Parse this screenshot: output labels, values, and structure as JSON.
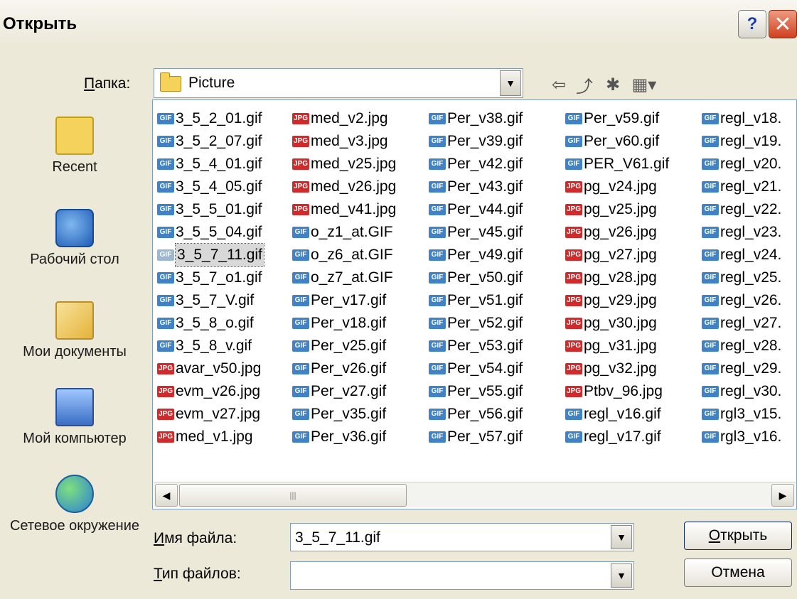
{
  "window": {
    "title": "Открыть",
    "help_label": "?",
    "close_label": "✕"
  },
  "folder": {
    "label": "Папка:",
    "accesskey": "П",
    "label_rest": "апка:",
    "value": "Picture"
  },
  "places": [
    {
      "label": "Recent",
      "icon": "recent-folder-icon"
    },
    {
      "label": "Рабочий стол",
      "icon": "desktop-icon"
    },
    {
      "label": "Мои документы",
      "icon": "my-documents-icon"
    },
    {
      "label": "Мой компьютер",
      "icon": "my-computer-icon"
    },
    {
      "label": "Сетевое окружение",
      "icon": "network-icon"
    }
  ],
  "columns": [
    [
      {
        "name": "3_5_2_01.gif",
        "type": "gif"
      },
      {
        "name": "3_5_2_07.gif",
        "type": "gif"
      },
      {
        "name": "3_5_4_01.gif",
        "type": "gif"
      },
      {
        "name": "3_5_4_05.gif",
        "type": "gif"
      },
      {
        "name": "3_5_5_01.gif",
        "type": "gif"
      },
      {
        "name": "3_5_5_04.gif",
        "type": "gif"
      },
      {
        "name": "3_5_7_11.gif",
        "type": "gif",
        "selected": true
      },
      {
        "name": "3_5_7_o1.gif",
        "type": "gif"
      },
      {
        "name": "3_5_7_V.gif",
        "type": "gif"
      },
      {
        "name": "3_5_8_o.gif",
        "type": "gif"
      },
      {
        "name": "3_5_8_v.gif",
        "type": "gif"
      },
      {
        "name": "avar_v50.jpg",
        "type": "jpg"
      },
      {
        "name": "evm_v26.jpg",
        "type": "jpg"
      },
      {
        "name": "evm_v27.jpg",
        "type": "jpg"
      },
      {
        "name": "med_v1.jpg",
        "type": "jpg"
      }
    ],
    [
      {
        "name": "med_v2.jpg",
        "type": "jpg"
      },
      {
        "name": "med_v3.jpg",
        "type": "jpg"
      },
      {
        "name": "med_v25.jpg",
        "type": "jpg"
      },
      {
        "name": "med_v26.jpg",
        "type": "jpg"
      },
      {
        "name": "med_v41.jpg",
        "type": "jpg"
      },
      {
        "name": "o_z1_at.GIF",
        "type": "gif"
      },
      {
        "name": "o_z6_at.GIF",
        "type": "gif"
      },
      {
        "name": "o_z7_at.GIF",
        "type": "gif"
      },
      {
        "name": "Per_v17.gif",
        "type": "gif"
      },
      {
        "name": "Per_v18.gif",
        "type": "gif"
      },
      {
        "name": "Per_v25.gif",
        "type": "gif"
      },
      {
        "name": "Per_v26.gif",
        "type": "gif"
      },
      {
        "name": "Per_v27.gif",
        "type": "gif"
      },
      {
        "name": "Per_v35.gif",
        "type": "gif"
      },
      {
        "name": "Per_v36.gif",
        "type": "gif"
      }
    ],
    [
      {
        "name": "Per_v38.gif",
        "type": "gif"
      },
      {
        "name": "Per_v39.gif",
        "type": "gif"
      },
      {
        "name": "Per_v42.gif",
        "type": "gif"
      },
      {
        "name": "Per_v43.gif",
        "type": "gif"
      },
      {
        "name": "Per_v44.gif",
        "type": "gif"
      },
      {
        "name": "Per_v45.gif",
        "type": "gif"
      },
      {
        "name": "Per_v49.gif",
        "type": "gif"
      },
      {
        "name": "Per_v50.gif",
        "type": "gif"
      },
      {
        "name": "Per_v51.gif",
        "type": "gif"
      },
      {
        "name": "Per_v52.gif",
        "type": "gif"
      },
      {
        "name": "Per_v53.gif",
        "type": "gif"
      },
      {
        "name": "Per_v54.gif",
        "type": "gif"
      },
      {
        "name": "Per_v55.gif",
        "type": "gif"
      },
      {
        "name": "Per_v56.gif",
        "type": "gif"
      },
      {
        "name": "Per_v57.gif",
        "type": "gif"
      }
    ],
    [
      {
        "name": "Per_v59.gif",
        "type": "gif"
      },
      {
        "name": "Per_v60.gif",
        "type": "gif"
      },
      {
        "name": "PER_V61.gif",
        "type": "gif"
      },
      {
        "name": "pg_v24.jpg",
        "type": "jpg"
      },
      {
        "name": "pg_v25.jpg",
        "type": "jpg"
      },
      {
        "name": "pg_v26.jpg",
        "type": "jpg"
      },
      {
        "name": "pg_v27.jpg",
        "type": "jpg"
      },
      {
        "name": "pg_v28.jpg",
        "type": "jpg"
      },
      {
        "name": "pg_v29.jpg",
        "type": "jpg"
      },
      {
        "name": "pg_v30.jpg",
        "type": "jpg"
      },
      {
        "name": "pg_v31.jpg",
        "type": "jpg"
      },
      {
        "name": "pg_v32.jpg",
        "type": "jpg"
      },
      {
        "name": "Ptbv_96.jpg",
        "type": "jpg"
      },
      {
        "name": "regl_v16.gif",
        "type": "gif"
      },
      {
        "name": "regl_v17.gif",
        "type": "gif"
      }
    ],
    [
      {
        "name": "regl_v18.",
        "type": "gif"
      },
      {
        "name": "regl_v19.",
        "type": "gif"
      },
      {
        "name": "regl_v20.",
        "type": "gif"
      },
      {
        "name": "regl_v21.",
        "type": "gif"
      },
      {
        "name": "regl_v22.",
        "type": "gif"
      },
      {
        "name": "regl_v23.",
        "type": "gif"
      },
      {
        "name": "regl_v24.",
        "type": "gif"
      },
      {
        "name": "regl_v25.",
        "type": "gif"
      },
      {
        "name": "regl_v26.",
        "type": "gif"
      },
      {
        "name": "regl_v27.",
        "type": "gif"
      },
      {
        "name": "regl_v28.",
        "type": "gif"
      },
      {
        "name": "regl_v29.",
        "type": "gif"
      },
      {
        "name": "regl_v30.",
        "type": "gif"
      },
      {
        "name": "rgl3_v15.",
        "type": "gif"
      },
      {
        "name": "rgl3_v16.",
        "type": "gif"
      }
    ]
  ],
  "file_icon_text": {
    "gif": "GIF",
    "jpg": "JPG"
  },
  "filename": {
    "label": "Имя файла:",
    "accesskey": "И",
    "label_rest": "мя файла:",
    "value": "3_5_7_11.gif"
  },
  "filetype": {
    "label": "Тип файлов:",
    "accesskey": "Т",
    "label_rest": "ип файлов:",
    "value": ""
  },
  "buttons": {
    "open_accesskey": "О",
    "open_rest": "ткрыть",
    "cancel": "Отмена"
  },
  "scrollbar": {
    "left_arrow": "◀",
    "right_arrow": "▶",
    "grip": "|||"
  },
  "combo_arrow": "▼",
  "toolbar": {
    "back": "⇦",
    "up": "⤴",
    "new_folder": "✱",
    "view": "▦▾"
  }
}
